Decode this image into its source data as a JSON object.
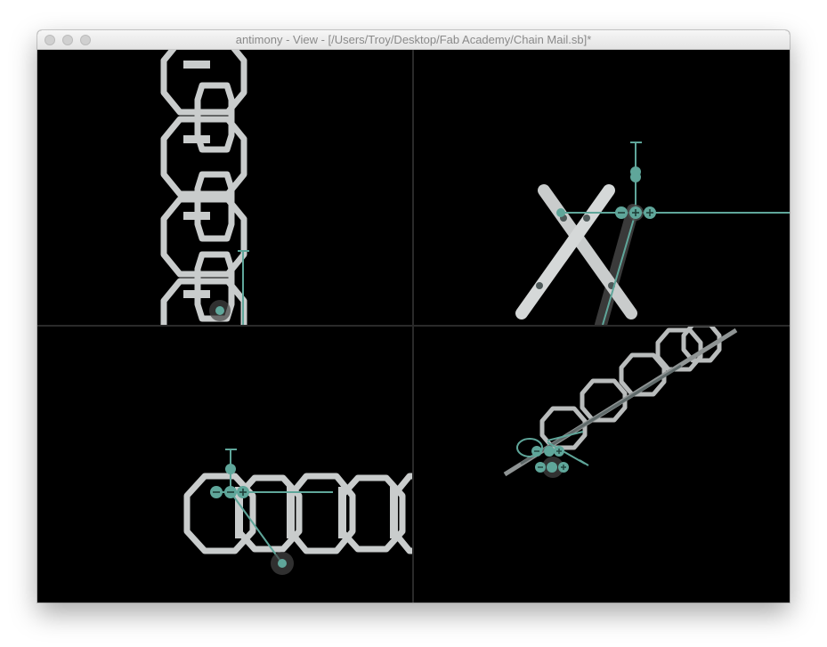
{
  "window": {
    "title": "antimony - View - [/Users/Troy/Desktop/Fab Academy/Chain Mail.sb]*",
    "buttons": [
      "close-button",
      "minimize-button",
      "zoom-button"
    ]
  },
  "colors": {
    "background": "#000000",
    "chain": "#c9cccc",
    "chain_shade": "#8f9494",
    "handle": "#5fa69a",
    "handle_dark": "#3f7f74",
    "divider": "#2a2a2a"
  },
  "viewports": [
    {
      "name": "viewport-top-left",
      "view": "front"
    },
    {
      "name": "viewport-top-right",
      "view": "side"
    },
    {
      "name": "viewport-bottom-left",
      "view": "top"
    },
    {
      "name": "viewport-bottom-right",
      "view": "3d"
    }
  ]
}
